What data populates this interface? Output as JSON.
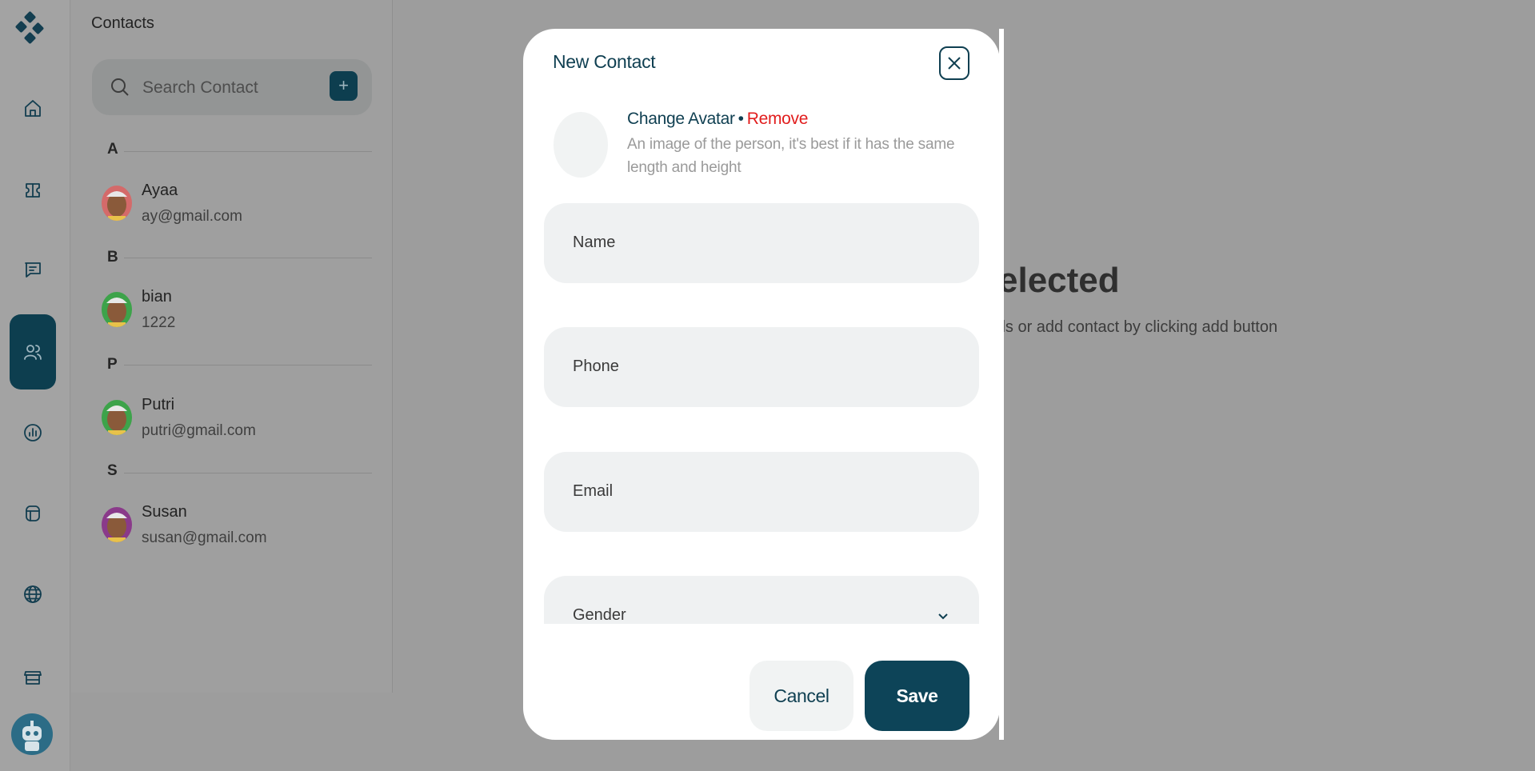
{
  "rail": {
    "items": [
      {
        "icon": "home-icon"
      },
      {
        "icon": "ticket-icon"
      },
      {
        "icon": "chat-icon"
      },
      {
        "icon": "contacts-icon",
        "active": true
      },
      {
        "icon": "analytics-icon"
      },
      {
        "icon": "layout-icon"
      },
      {
        "icon": "globe-icon"
      },
      {
        "icon": "store-icon"
      }
    ],
    "accent_color": "#0d3e4f"
  },
  "contacts": {
    "title": "Contacts",
    "search_placeholder": "Search Contact",
    "add_label": "+",
    "groups": [
      {
        "letter": "A",
        "items": [
          {
            "name": "Ayaa",
            "sub": "ay@gmail.com"
          }
        ]
      },
      {
        "letter": "B",
        "items": [
          {
            "name": "bian",
            "sub": "1222"
          }
        ]
      },
      {
        "letter": "P",
        "items": [
          {
            "name": "Putri",
            "sub": "putri@gmail.com"
          }
        ]
      },
      {
        "letter": "S",
        "items": [
          {
            "name": "Susan",
            "sub": "susan@gmail.com"
          }
        ]
      }
    ]
  },
  "empty_state": {
    "title": "elected",
    "subtitle": "ils or add contact by clicking add button"
  },
  "modal": {
    "title": "New Contact",
    "change_avatar": "Change Avatar",
    "separator": "•",
    "remove": "Remove",
    "avatar_hint": "An image of the person, it's best if it has the same length and height",
    "fields": {
      "name": "Name",
      "phone": "Phone",
      "email": "Email",
      "gender": "Gender"
    },
    "cancel": "Cancel",
    "save": "Save",
    "colors": {
      "primary": "#0f3f51",
      "danger": "#e11d1d"
    }
  }
}
